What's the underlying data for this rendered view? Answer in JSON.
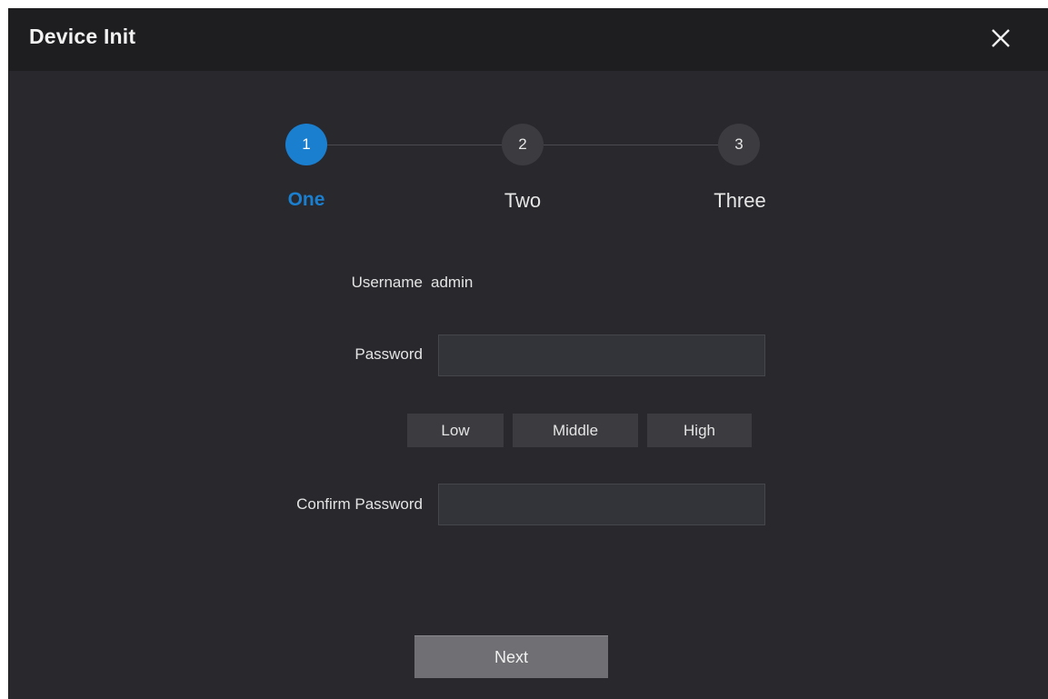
{
  "dialog": {
    "title": "Device Init",
    "close_icon": "close-icon"
  },
  "steps": [
    {
      "number": "1",
      "label": "One",
      "active": true
    },
    {
      "number": "2",
      "label": "Two",
      "active": false
    },
    {
      "number": "3",
      "label": "Three",
      "active": false
    }
  ],
  "form": {
    "username_label": "Username",
    "username_value": "admin",
    "password_label": "Password",
    "password_value": "",
    "strength_levels": [
      "Low",
      "Middle",
      "High"
    ],
    "confirm_label": "Confirm Password",
    "confirm_value": ""
  },
  "actions": {
    "next_label": "Next"
  },
  "colors": {
    "accent": "#1b7fd0",
    "background": "#28282d",
    "titlebar": "#1e1e21"
  }
}
